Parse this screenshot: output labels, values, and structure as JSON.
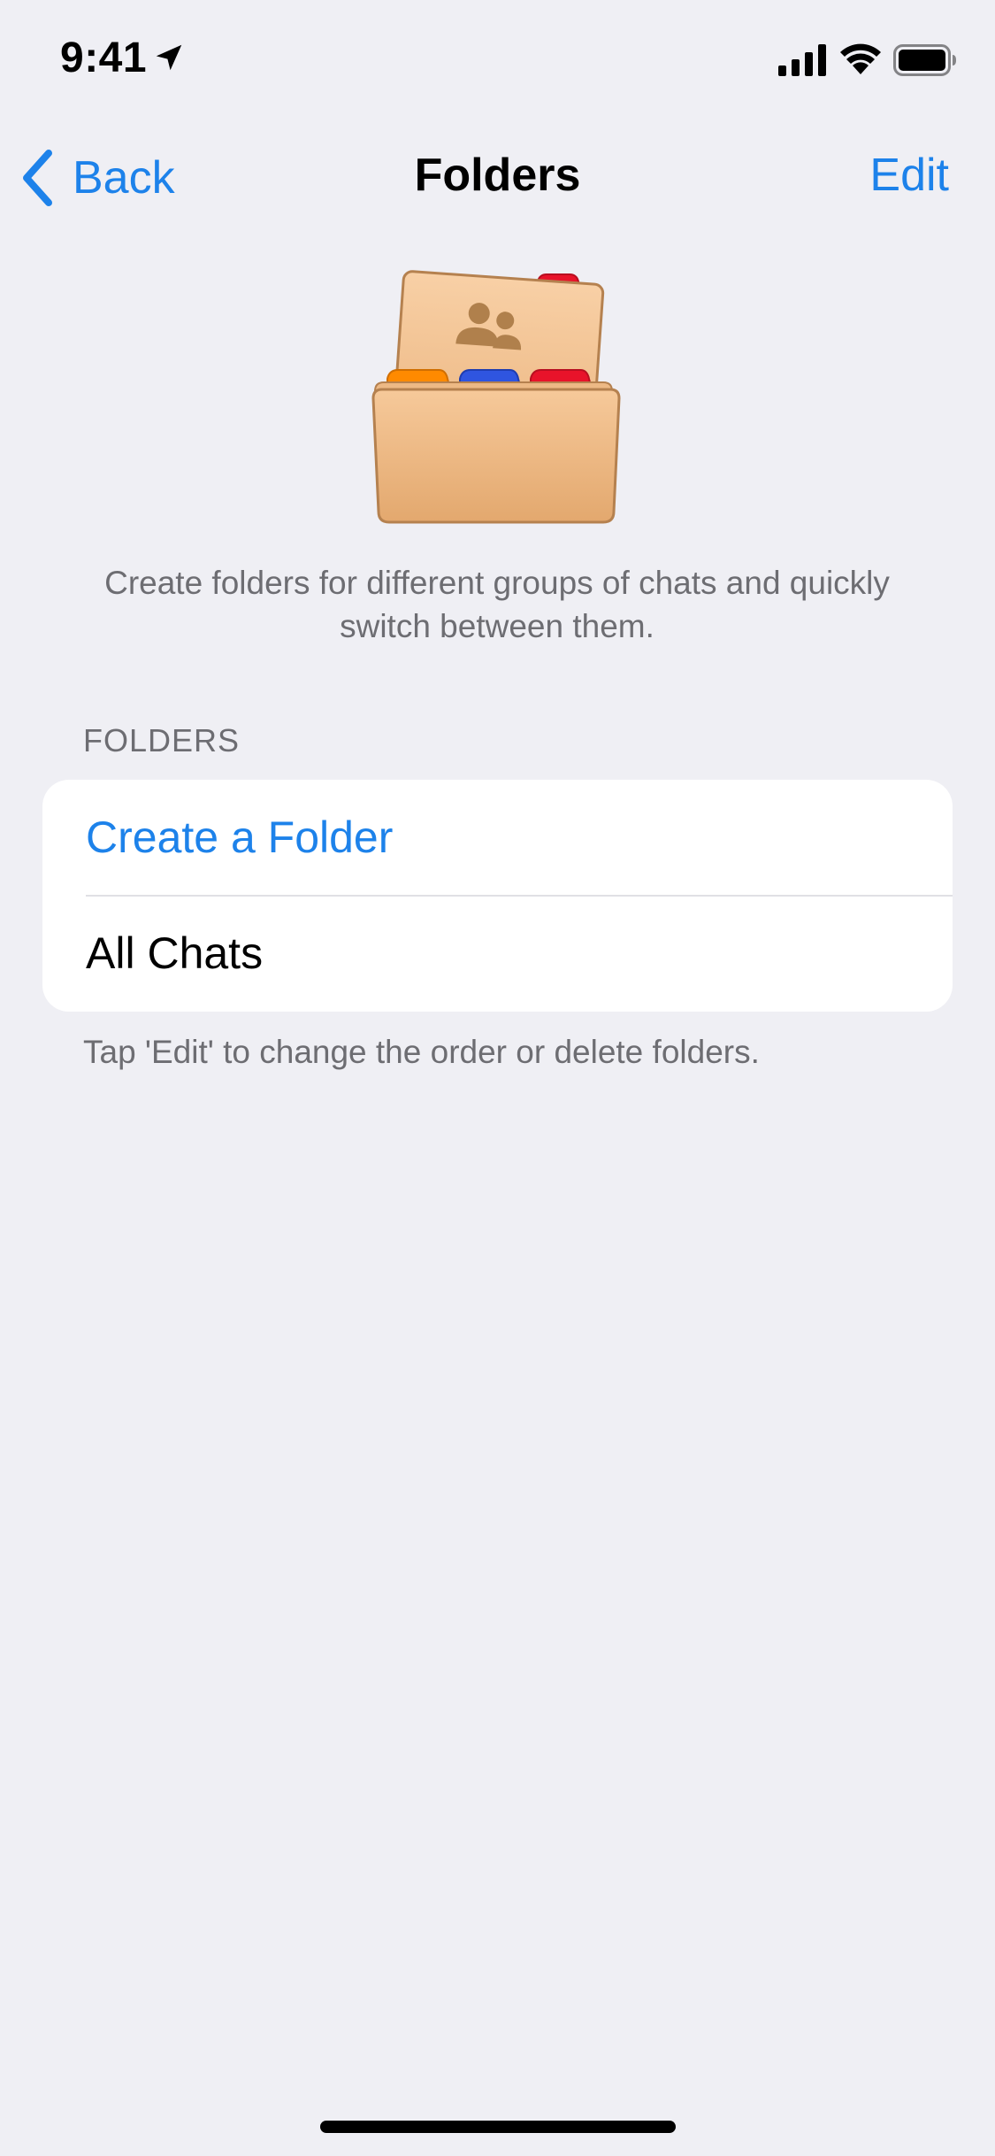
{
  "status_bar": {
    "time": "9:41",
    "icons": [
      "location-arrow-icon",
      "cellular-signal-icon",
      "wifi-icon",
      "battery-icon"
    ]
  },
  "nav": {
    "back_label": "Back",
    "title": "Folders",
    "edit_label": "Edit"
  },
  "hero": {
    "icon": "folders-illustration-icon"
  },
  "description": "Create folders for different groups of chats and quickly switch between them.",
  "section": {
    "header": "FOLDERS",
    "items": [
      {
        "label": "Create a Folder"
      },
      {
        "label": "All Chats"
      }
    ],
    "footer": "Tap 'Edit' to change the order or delete folders."
  },
  "colors": {
    "background": "#EFEFF4",
    "accent": "#1D82EA",
    "secondary_text": "#6D6D72",
    "card": "#FFFFFF"
  }
}
